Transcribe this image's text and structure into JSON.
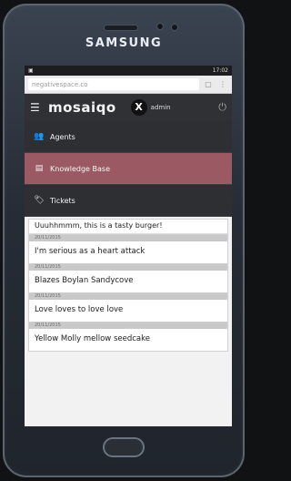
{
  "device": {
    "brand": "SAMSUNG"
  },
  "status": {
    "time": "17:02"
  },
  "browser": {
    "url": "negativespace.co"
  },
  "app": {
    "logo": "mosaiqo",
    "avatar": "X",
    "user": "admin"
  },
  "menu": [
    {
      "label": "Agents",
      "icon": "users-icon",
      "active": false
    },
    {
      "label": "Knowledge Base",
      "icon": "book-icon",
      "active": true
    },
    {
      "label": "Tickets",
      "icon": "tag-icon",
      "active": false
    }
  ],
  "feed": {
    "first": "Uuuhhmmm, this is a tasty burger!",
    "posts": [
      {
        "meta": "20/11/2015",
        "text": "I'm serious as a heart attack"
      },
      {
        "meta": "20/11/2015",
        "text": "Blazes Boylan Sandycove"
      },
      {
        "meta": "20/11/2015",
        "text": "Love loves to love love"
      },
      {
        "meta": "20/11/2015",
        "text": "Yellow Molly mellow seedcake"
      }
    ]
  },
  "colors": {
    "active_menu": "#9b5a63",
    "appbar": "#2f3134"
  }
}
